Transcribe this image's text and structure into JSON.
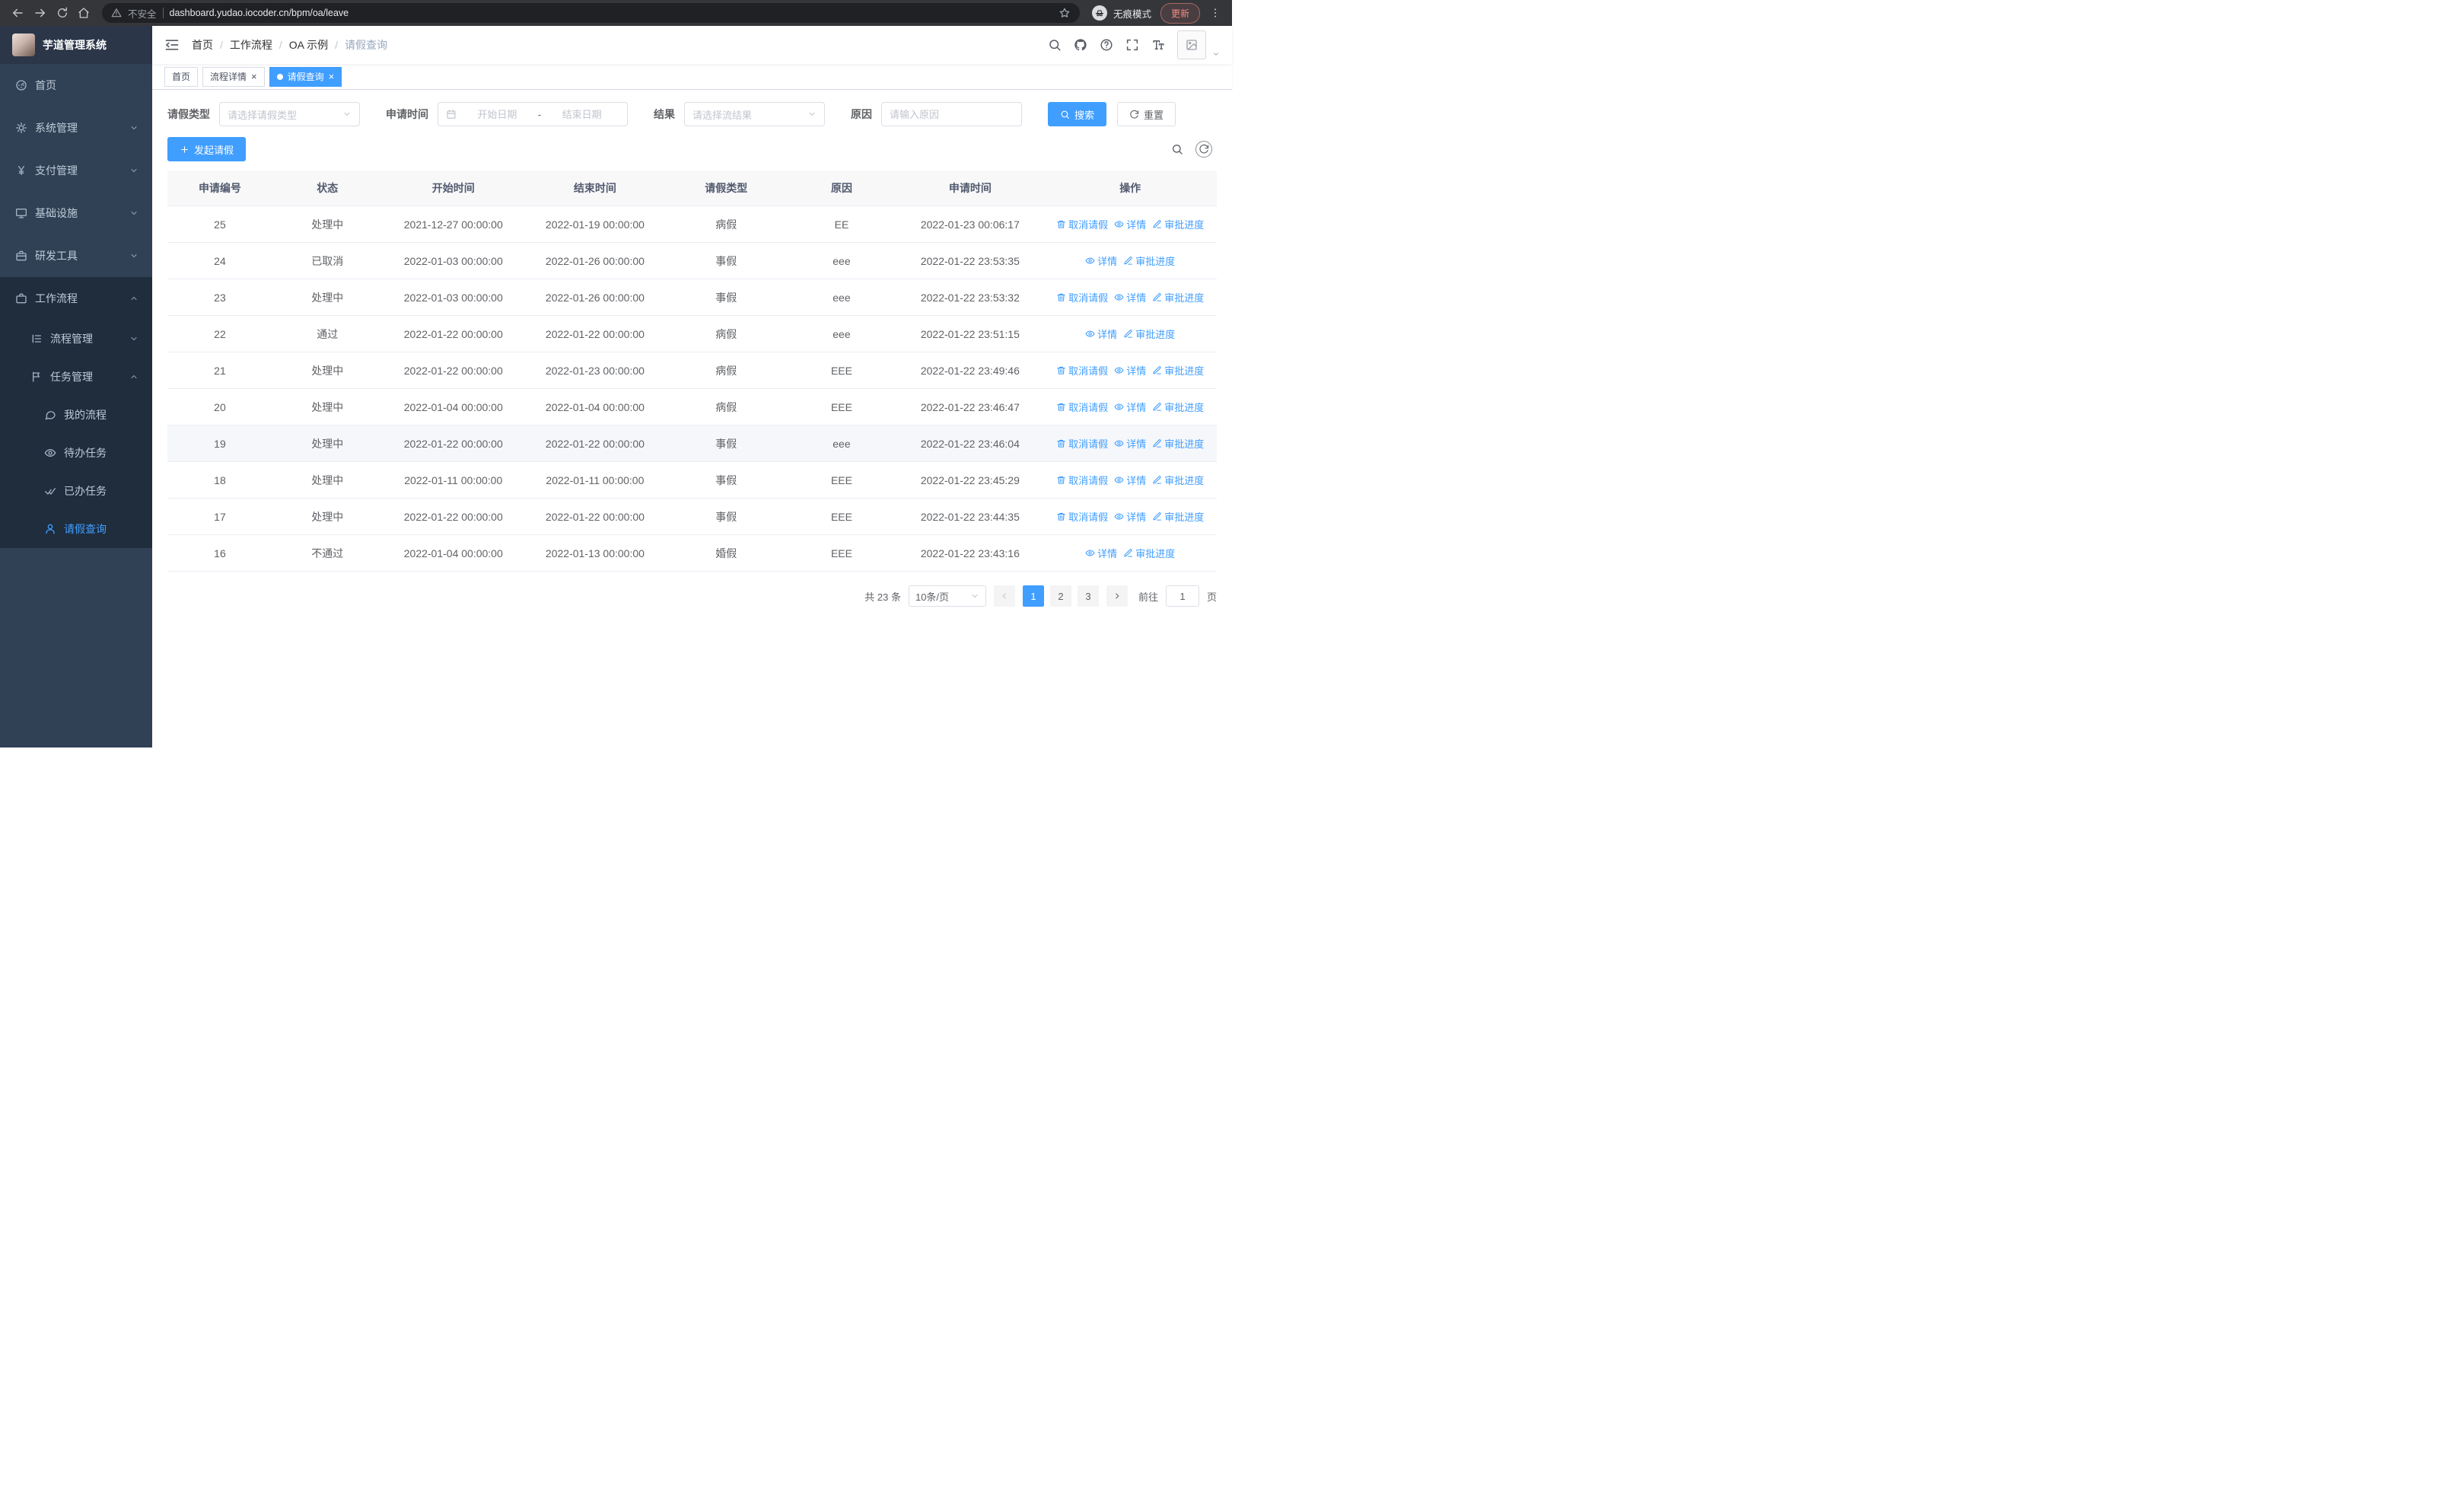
{
  "browser": {
    "security_warning": "不安全",
    "url": "dashboard.yudao.iocoder.cn/bpm/oa/leave",
    "incognito_label": "无痕模式",
    "update_label": "更新"
  },
  "sidebar": {
    "logo_title": "芋道管理系统",
    "items": [
      {
        "key": "home",
        "label": "首页",
        "icon": "dashboard-icon",
        "level": 1
      },
      {
        "key": "system",
        "label": "系统管理",
        "icon": "gear-icon",
        "level": 1,
        "chevron": "down"
      },
      {
        "key": "payment",
        "label": "支付管理",
        "icon": "yen-icon",
        "level": 1,
        "chevron": "down"
      },
      {
        "key": "infrastructure",
        "label": "基础设施",
        "icon": "monitor-icon",
        "level": 1,
        "chevron": "down"
      },
      {
        "key": "devtools",
        "label": "研发工具",
        "icon": "suitcase-icon",
        "level": 1,
        "chevron": "down"
      },
      {
        "key": "workflow",
        "label": "工作流程",
        "icon": "briefcase-icon",
        "level": 1,
        "chevron": "up",
        "dark": true
      },
      {
        "key": "process-management",
        "label": "流程管理",
        "icon": "list-icon",
        "level": 2,
        "chevron": "down",
        "dark": true
      },
      {
        "key": "task-management",
        "label": "任务管理",
        "icon": "flag-icon",
        "level": 2,
        "chevron": "up",
        "dark": true
      },
      {
        "key": "my-process",
        "label": "我的流程",
        "icon": "message-icon",
        "level": 3,
        "dark": true
      },
      {
        "key": "todo-tasks",
        "label": "待办任务",
        "icon": "eye-icon",
        "level": 3,
        "dark": true
      },
      {
        "key": "done-tasks",
        "label": "已办任务",
        "icon": "done-icon",
        "level": 3,
        "dark": true
      },
      {
        "key": "leave-query",
        "label": "请假查询",
        "icon": "user-icon",
        "level": 3,
        "dark": true,
        "active": true
      }
    ]
  },
  "header": {
    "breadcrumb": [
      "首页",
      "工作流程",
      "OA 示例",
      "请假查询"
    ]
  },
  "tabs": [
    {
      "key": "home",
      "label": "首页",
      "closable": false,
      "active": false
    },
    {
      "key": "process-detail",
      "label": "流程详情",
      "closable": true,
      "active": false
    },
    {
      "key": "leave-query",
      "label": "请假查询",
      "closable": true,
      "active": true
    }
  ],
  "filters": {
    "leave_type_label": "请假类型",
    "leave_type_placeholder": "请选择请假类型",
    "apply_time_label": "申请时间",
    "start_placeholder": "开始日期",
    "range_separator": "-",
    "end_placeholder": "结束日期",
    "result_label": "结果",
    "result_placeholder": "请选择流结果",
    "reason_label": "原因",
    "reason_placeholder": "请输入原因",
    "search_label": "搜索",
    "reset_label": "重置"
  },
  "toolbar": {
    "create_label": "发起请假"
  },
  "table": {
    "columns": [
      "申请编号",
      "状态",
      "开始时间",
      "结束时间",
      "请假类型",
      "原因",
      "申请时间",
      "操作"
    ],
    "action_defs": {
      "cancel": {
        "label": "取消请假",
        "icon": "delete-icon"
      },
      "detail": {
        "label": "详情",
        "icon": "view-icon"
      },
      "progress": {
        "label": "审批进度",
        "icon": "edit-icon"
      }
    },
    "rows": [
      {
        "id": "25",
        "status": "处理中",
        "start": "2021-12-27 00:00:00",
        "end": "2022-01-19 00:00:00",
        "type": "病假",
        "reason": "EE",
        "applied": "2022-01-23 00:06:17",
        "actions": [
          "cancel",
          "detail",
          "progress"
        ]
      },
      {
        "id": "24",
        "status": "已取消",
        "start": "2022-01-03 00:00:00",
        "end": "2022-01-26 00:00:00",
        "type": "事假",
        "reason": "eee",
        "applied": "2022-01-22 23:53:35",
        "actions": [
          "detail",
          "progress"
        ]
      },
      {
        "id": "23",
        "status": "处理中",
        "start": "2022-01-03 00:00:00",
        "end": "2022-01-26 00:00:00",
        "type": "事假",
        "reason": "eee",
        "applied": "2022-01-22 23:53:32",
        "actions": [
          "cancel",
          "detail",
          "progress"
        ]
      },
      {
        "id": "22",
        "status": "通过",
        "start": "2022-01-22 00:00:00",
        "end": "2022-01-22 00:00:00",
        "type": "病假",
        "reason": "eee",
        "applied": "2022-01-22 23:51:15",
        "actions": [
          "detail",
          "progress"
        ]
      },
      {
        "id": "21",
        "status": "处理中",
        "start": "2022-01-22 00:00:00",
        "end": "2022-01-23 00:00:00",
        "type": "病假",
        "reason": "EEE",
        "applied": "2022-01-22 23:49:46",
        "actions": [
          "cancel",
          "detail",
          "progress"
        ]
      },
      {
        "id": "20",
        "status": "处理中",
        "start": "2022-01-04 00:00:00",
        "end": "2022-01-04 00:00:00",
        "type": "病假",
        "reason": "EEE",
        "applied": "2022-01-22 23:46:47",
        "actions": [
          "cancel",
          "detail",
          "progress"
        ]
      },
      {
        "id": "19",
        "status": "处理中",
        "start": "2022-01-22 00:00:00",
        "end": "2022-01-22 00:00:00",
        "type": "事假",
        "reason": "eee",
        "applied": "2022-01-22 23:46:04",
        "actions": [
          "cancel",
          "detail",
          "progress"
        ],
        "highlighted": true
      },
      {
        "id": "18",
        "status": "处理中",
        "start": "2022-01-11 00:00:00",
        "end": "2022-01-11 00:00:00",
        "type": "事假",
        "reason": "EEE",
        "applied": "2022-01-22 23:45:29",
        "actions": [
          "cancel",
          "detail",
          "progress"
        ]
      },
      {
        "id": "17",
        "status": "处理中",
        "start": "2022-01-22 00:00:00",
        "end": "2022-01-22 00:00:00",
        "type": "事假",
        "reason": "EEE",
        "applied": "2022-01-22 23:44:35",
        "actions": [
          "cancel",
          "detail",
          "progress"
        ]
      },
      {
        "id": "16",
        "status": "不通过",
        "start": "2022-01-04 00:00:00",
        "end": "2022-01-13 00:00:00",
        "type": "婚假",
        "reason": "EEE",
        "applied": "2022-01-22 23:43:16",
        "actions": [
          "detail",
          "progress"
        ]
      }
    ]
  },
  "pagination": {
    "total_label": "共 23 条",
    "page_size_label": "10条/页",
    "pages": [
      "1",
      "2",
      "3"
    ],
    "active_page": "1",
    "goto_label": "前往",
    "goto_value": "1",
    "page_unit_label": "页"
  },
  "colors": {
    "primary": "#409eff",
    "sidebar_bg": "#304156",
    "sidebar_sub_bg": "#1f2d3d",
    "chrome_bg": "#35363a",
    "table_header_bg": "#f8f8f9"
  }
}
